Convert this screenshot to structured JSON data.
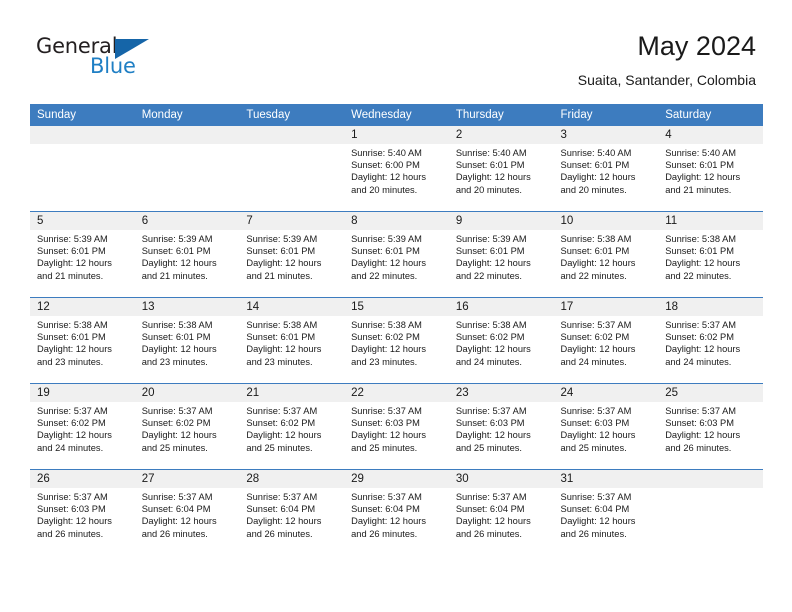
{
  "brand": {
    "name_part1": "General",
    "name_part2": "Blue",
    "flag_icon": "blue-triangle-flag",
    "accent_color": "#1f7fc4",
    "header_color": "#3d7cbf"
  },
  "header": {
    "title": "May 2024",
    "subtitle": "Suaita, Santander, Colombia"
  },
  "weekday_headers": [
    "Sunday",
    "Monday",
    "Tuesday",
    "Wednesday",
    "Thursday",
    "Friday",
    "Saturday"
  ],
  "weeks": [
    [
      {
        "day": "",
        "lines": []
      },
      {
        "day": "",
        "lines": []
      },
      {
        "day": "",
        "lines": []
      },
      {
        "day": "1",
        "lines": [
          "Sunrise: 5:40 AM",
          "Sunset: 6:00 PM",
          "Daylight: 12 hours",
          "and 20 minutes."
        ]
      },
      {
        "day": "2",
        "lines": [
          "Sunrise: 5:40 AM",
          "Sunset: 6:01 PM",
          "Daylight: 12 hours",
          "and 20 minutes."
        ]
      },
      {
        "day": "3",
        "lines": [
          "Sunrise: 5:40 AM",
          "Sunset: 6:01 PM",
          "Daylight: 12 hours",
          "and 20 minutes."
        ]
      },
      {
        "day": "4",
        "lines": [
          "Sunrise: 5:40 AM",
          "Sunset: 6:01 PM",
          "Daylight: 12 hours",
          "and 21 minutes."
        ]
      }
    ],
    [
      {
        "day": "5",
        "lines": [
          "Sunrise: 5:39 AM",
          "Sunset: 6:01 PM",
          "Daylight: 12 hours",
          "and 21 minutes."
        ]
      },
      {
        "day": "6",
        "lines": [
          "Sunrise: 5:39 AM",
          "Sunset: 6:01 PM",
          "Daylight: 12 hours",
          "and 21 minutes."
        ]
      },
      {
        "day": "7",
        "lines": [
          "Sunrise: 5:39 AM",
          "Sunset: 6:01 PM",
          "Daylight: 12 hours",
          "and 21 minutes."
        ]
      },
      {
        "day": "8",
        "lines": [
          "Sunrise: 5:39 AM",
          "Sunset: 6:01 PM",
          "Daylight: 12 hours",
          "and 22 minutes."
        ]
      },
      {
        "day": "9",
        "lines": [
          "Sunrise: 5:39 AM",
          "Sunset: 6:01 PM",
          "Daylight: 12 hours",
          "and 22 minutes."
        ]
      },
      {
        "day": "10",
        "lines": [
          "Sunrise: 5:38 AM",
          "Sunset: 6:01 PM",
          "Daylight: 12 hours",
          "and 22 minutes."
        ]
      },
      {
        "day": "11",
        "lines": [
          "Sunrise: 5:38 AM",
          "Sunset: 6:01 PM",
          "Daylight: 12 hours",
          "and 22 minutes."
        ]
      }
    ],
    [
      {
        "day": "12",
        "lines": [
          "Sunrise: 5:38 AM",
          "Sunset: 6:01 PM",
          "Daylight: 12 hours",
          "and 23 minutes."
        ]
      },
      {
        "day": "13",
        "lines": [
          "Sunrise: 5:38 AM",
          "Sunset: 6:01 PM",
          "Daylight: 12 hours",
          "and 23 minutes."
        ]
      },
      {
        "day": "14",
        "lines": [
          "Sunrise: 5:38 AM",
          "Sunset: 6:01 PM",
          "Daylight: 12 hours",
          "and 23 minutes."
        ]
      },
      {
        "day": "15",
        "lines": [
          "Sunrise: 5:38 AM",
          "Sunset: 6:02 PM",
          "Daylight: 12 hours",
          "and 23 minutes."
        ]
      },
      {
        "day": "16",
        "lines": [
          "Sunrise: 5:38 AM",
          "Sunset: 6:02 PM",
          "Daylight: 12 hours",
          "and 24 minutes."
        ]
      },
      {
        "day": "17",
        "lines": [
          "Sunrise: 5:37 AM",
          "Sunset: 6:02 PM",
          "Daylight: 12 hours",
          "and 24 minutes."
        ]
      },
      {
        "day": "18",
        "lines": [
          "Sunrise: 5:37 AM",
          "Sunset: 6:02 PM",
          "Daylight: 12 hours",
          "and 24 minutes."
        ]
      }
    ],
    [
      {
        "day": "19",
        "lines": [
          "Sunrise: 5:37 AM",
          "Sunset: 6:02 PM",
          "Daylight: 12 hours",
          "and 24 minutes."
        ]
      },
      {
        "day": "20",
        "lines": [
          "Sunrise: 5:37 AM",
          "Sunset: 6:02 PM",
          "Daylight: 12 hours",
          "and 25 minutes."
        ]
      },
      {
        "day": "21",
        "lines": [
          "Sunrise: 5:37 AM",
          "Sunset: 6:02 PM",
          "Daylight: 12 hours",
          "and 25 minutes."
        ]
      },
      {
        "day": "22",
        "lines": [
          "Sunrise: 5:37 AM",
          "Sunset: 6:03 PM",
          "Daylight: 12 hours",
          "and 25 minutes."
        ]
      },
      {
        "day": "23",
        "lines": [
          "Sunrise: 5:37 AM",
          "Sunset: 6:03 PM",
          "Daylight: 12 hours",
          "and 25 minutes."
        ]
      },
      {
        "day": "24",
        "lines": [
          "Sunrise: 5:37 AM",
          "Sunset: 6:03 PM",
          "Daylight: 12 hours",
          "and 25 minutes."
        ]
      },
      {
        "day": "25",
        "lines": [
          "Sunrise: 5:37 AM",
          "Sunset: 6:03 PM",
          "Daylight: 12 hours",
          "and 26 minutes."
        ]
      }
    ],
    [
      {
        "day": "26",
        "lines": [
          "Sunrise: 5:37 AM",
          "Sunset: 6:03 PM",
          "Daylight: 12 hours",
          "and 26 minutes."
        ]
      },
      {
        "day": "27",
        "lines": [
          "Sunrise: 5:37 AM",
          "Sunset: 6:04 PM",
          "Daylight: 12 hours",
          "and 26 minutes."
        ]
      },
      {
        "day": "28",
        "lines": [
          "Sunrise: 5:37 AM",
          "Sunset: 6:04 PM",
          "Daylight: 12 hours",
          "and 26 minutes."
        ]
      },
      {
        "day": "29",
        "lines": [
          "Sunrise: 5:37 AM",
          "Sunset: 6:04 PM",
          "Daylight: 12 hours",
          "and 26 minutes."
        ]
      },
      {
        "day": "30",
        "lines": [
          "Sunrise: 5:37 AM",
          "Sunset: 6:04 PM",
          "Daylight: 12 hours",
          "and 26 minutes."
        ]
      },
      {
        "day": "31",
        "lines": [
          "Sunrise: 5:37 AM",
          "Sunset: 6:04 PM",
          "Daylight: 12 hours",
          "and 26 minutes."
        ]
      },
      {
        "day": "",
        "lines": []
      }
    ]
  ]
}
